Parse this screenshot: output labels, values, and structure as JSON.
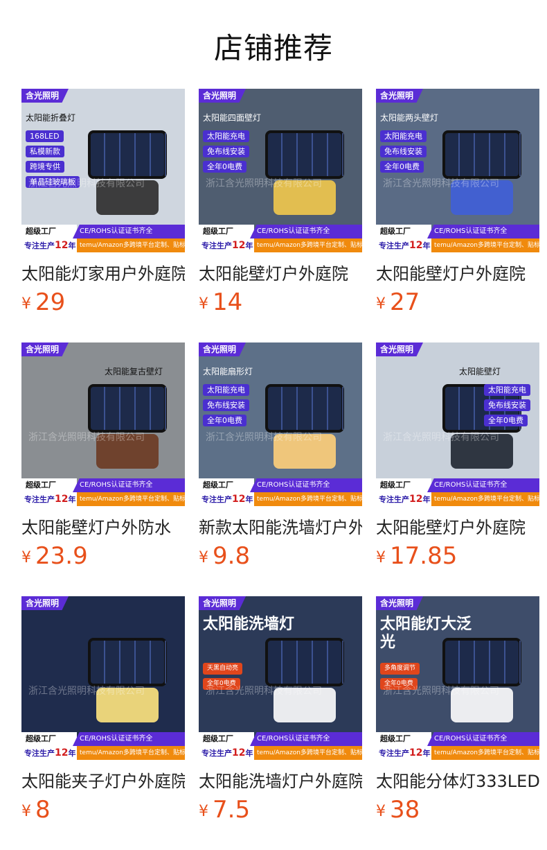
{
  "page": {
    "title": "店铺推荐"
  },
  "shared": {
    "brand": "含光照明",
    "factory": "超级工厂",
    "cert": "CE/ROHS认证证书齐全",
    "years_prefix": "专注生产",
    "years_num": "12",
    "years_suffix": "年",
    "custom": "temu/Amazon多跨境平台定制、贴标",
    "currency": "¥"
  },
  "products": [
    {
      "name": "太阳能灯家用户外庭院",
      "price": "29",
      "tag": "太阳能折叠灯",
      "features": [
        "168LED",
        "私模新款",
        "跨境专供",
        "单晶硅玻璃板"
      ],
      "watermark": "浙江含光照明科技有限公司",
      "bg": "#cfd6df",
      "accent": "#2b2b2b"
    },
    {
      "name": "太阳能壁灯户外庭院",
      "price": "14",
      "tag": "太阳能四面壁灯",
      "features": [
        "太阳能充电",
        "免布线安装",
        "全年0电费"
      ],
      "watermark": "浙江含光照明科技有限公司",
      "bg": "#4f5d70",
      "accent": "#f2c94c"
    },
    {
      "name": "太阳能壁灯户外庭院",
      "price": "27",
      "tag": "太阳能两头壁灯",
      "features": [
        "太阳能充电",
        "免布线安装",
        "全年0电费"
      ],
      "watermark": "浙江含光照明科技有限公司",
      "bg": "#5a6b85",
      "accent": "#3f5fd8"
    },
    {
      "name": "太阳能壁灯户外防水",
      "price": "23.9",
      "tag": "太阳能复古壁灯",
      "features": [],
      "watermark": "浙江含光照明科技有限公司",
      "bg": "#8a8e92",
      "accent": "#6b3a22"
    },
    {
      "name": "新款太阳能洗墙灯户外",
      "price": "9.8",
      "tag": "太阳能扇形灯",
      "features": [
        "太阳能充电",
        "免布线安装",
        "全年0电费"
      ],
      "watermark": "浙江含光照明科技有限公司",
      "bg": "#5d7088",
      "accent": "#ffcf7a"
    },
    {
      "name": "太阳能壁灯户外庭院",
      "price": "17.85",
      "tag": "太阳能壁灯",
      "features": [
        "太阳能充电",
        "免布线安装",
        "全年0电费"
      ],
      "watermark": "浙江含光照明科技有限公司",
      "bg": "#c8d0da",
      "accent": "#1e2530"
    },
    {
      "name": "太阳能夹子灯户外庭院",
      "price": "8",
      "tag": "",
      "features": [],
      "watermark": "浙江含光照明科技有限公司",
      "bg": "#1f2c4d",
      "accent": "#ffe680"
    },
    {
      "name": "太阳能洗墙灯户外庭院",
      "price": "7.5",
      "tag": "太阳能洗墙灯",
      "features": [
        "天黑自动亮",
        "全年0电费"
      ],
      "watermark": "浙江含光照明科技有限公司",
      "bg": "#2c3a58",
      "accent": "#ffffff"
    },
    {
      "name": "太阳能分体灯333LED",
      "price": "38",
      "tag": "太阳能灯大泛光",
      "features": [
        "多角度调节",
        "全年0电费"
      ],
      "watermark": "浙江含光照明科技有限公司",
      "bg": "#3e4d6a",
      "accent": "#ffffff"
    }
  ]
}
